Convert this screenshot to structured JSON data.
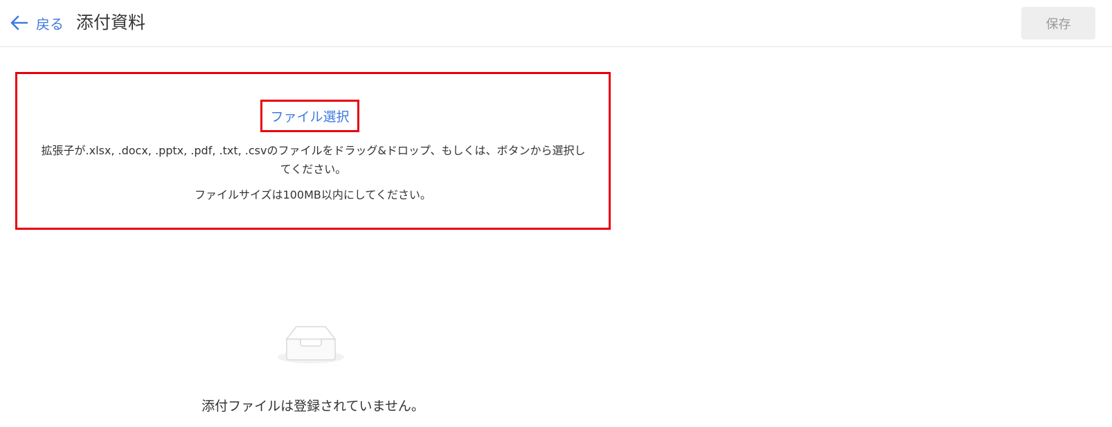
{
  "header": {
    "back_label": "戻る",
    "title": "添付資料",
    "save_label": "保存"
  },
  "upload": {
    "select_label": "ファイル選択",
    "instructions": "拡張子が.xlsx, .docx, .pptx, .pdf, .txt, .csvのファイルをドラッグ&ドロップ、もしくは、ボタンから選択してください。",
    "size_note": "ファイルサイズは100MB以内にしてください。"
  },
  "empty_state": {
    "icon": "inbox-icon",
    "message": "添付ファイルは登録されていません。"
  },
  "colors": {
    "link": "#3d7be0",
    "highlight_border": "#e8000b",
    "disabled_button_bg": "#eeeeee",
    "disabled_button_text": "#9a9a9a"
  }
}
